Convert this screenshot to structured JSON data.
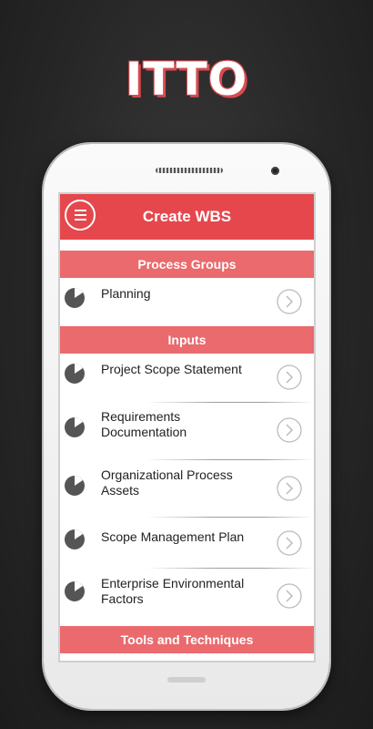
{
  "banner": {
    "title": "ITTO"
  },
  "app": {
    "title": "Create WBS",
    "menu_icon": "hamburger-menu-icon",
    "accent_color": "#e5474d",
    "section_color": "#ea6a6e"
  },
  "sections": [
    {
      "header": "Process Groups",
      "items": [
        {
          "label": "Planning",
          "icon": "pie-chart-icon"
        }
      ]
    },
    {
      "header": "Inputs",
      "items": [
        {
          "label": "Project Scope Statement",
          "icon": "pie-chart-icon"
        },
        {
          "label": "Requirements Documentation",
          "icon": "pie-chart-icon"
        },
        {
          "label": "Organizational Process Assets",
          "icon": "pie-chart-icon"
        },
        {
          "label": "Scope Management Plan",
          "icon": "pie-chart-icon"
        },
        {
          "label": "Enterprise Environmental Factors",
          "icon": "pie-chart-icon"
        }
      ]
    },
    {
      "header": "Tools and Techniques",
      "items": []
    }
  ]
}
